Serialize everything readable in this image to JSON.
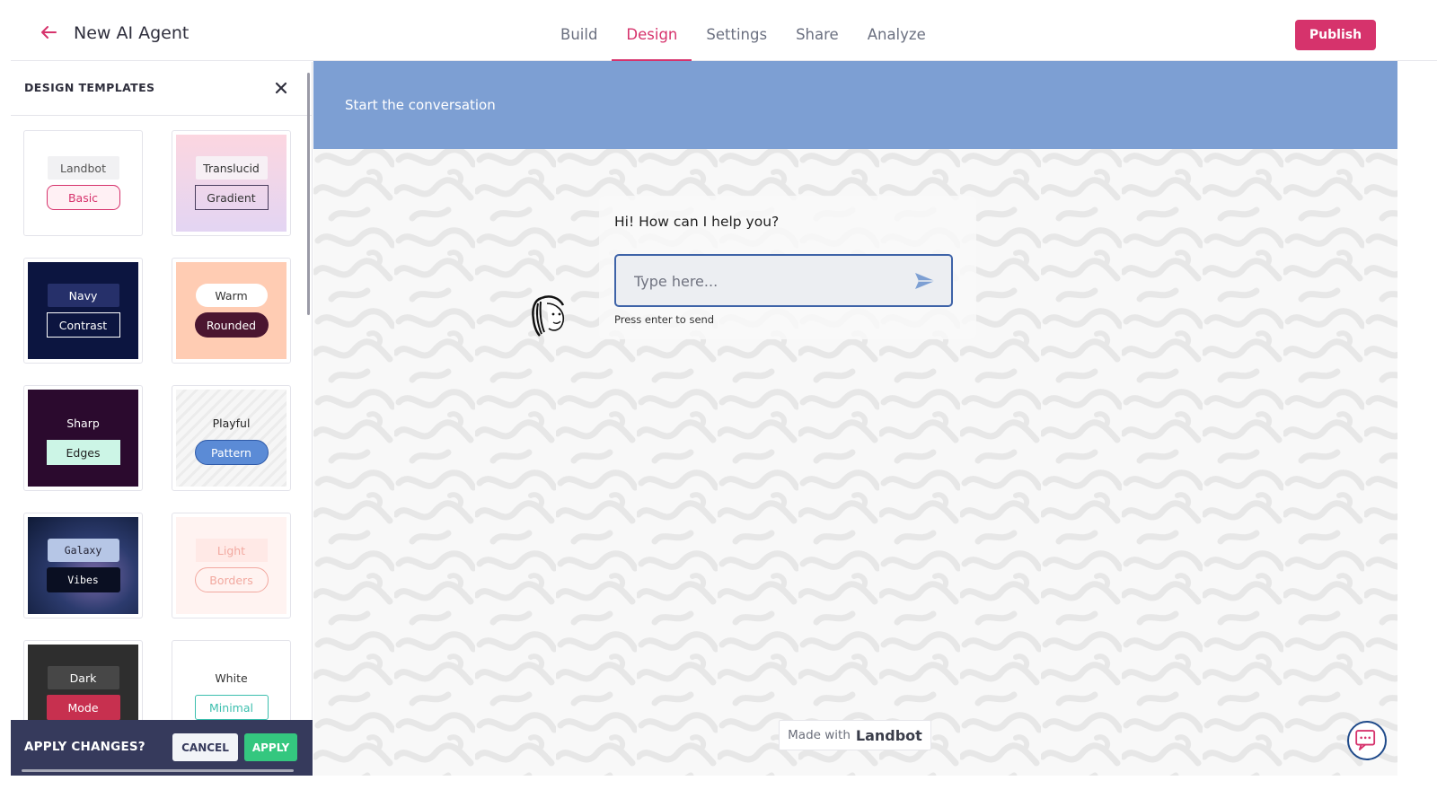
{
  "header": {
    "title": "New AI Agent",
    "tabs": [
      {
        "label": "Build"
      },
      {
        "label": "Design"
      },
      {
        "label": "Settings"
      },
      {
        "label": "Share"
      },
      {
        "label": "Analyze"
      }
    ],
    "active_tab": "Design",
    "publish_label": "Publish",
    "accent_color": "#d6336c"
  },
  "panel": {
    "title": "DESIGN TEMPLATES",
    "templates": [
      {
        "line1": "Landbot",
        "line2": "Basic"
      },
      {
        "line1": "Translucid",
        "line2": "Gradient"
      },
      {
        "line1": "Navy",
        "line2": "Contrast"
      },
      {
        "line1": "Warm",
        "line2": "Rounded"
      },
      {
        "line1": "Sharp",
        "line2": "Edges"
      },
      {
        "line1": "Playful",
        "line2": "Pattern"
      },
      {
        "line1": "Galaxy",
        "line2": "Vibes"
      },
      {
        "line1": "Light",
        "line2": "Borders"
      },
      {
        "line1": "Dark",
        "line2": "Mode"
      },
      {
        "line1": "White",
        "line2": "Minimal"
      }
    ]
  },
  "apply_bar": {
    "label": "APPLY CHANGES?",
    "cancel_label": "CANCEL",
    "apply_label": "APPLY"
  },
  "preview": {
    "header_text": "Start the conversation",
    "bot_message": "Hi! How can I help you?",
    "input_placeholder": "Type here...",
    "input_value": "",
    "hint": "Press enter to send",
    "made_with_prefix": "Made with",
    "made_with_brand": "Landbot",
    "header_color": "#7d9fd3"
  },
  "icons": {
    "back": "arrow-left-icon",
    "close": "close-icon",
    "send": "send-icon",
    "launcher": "chat-bubble-icon",
    "avatar": "bot-avatar-icon"
  }
}
